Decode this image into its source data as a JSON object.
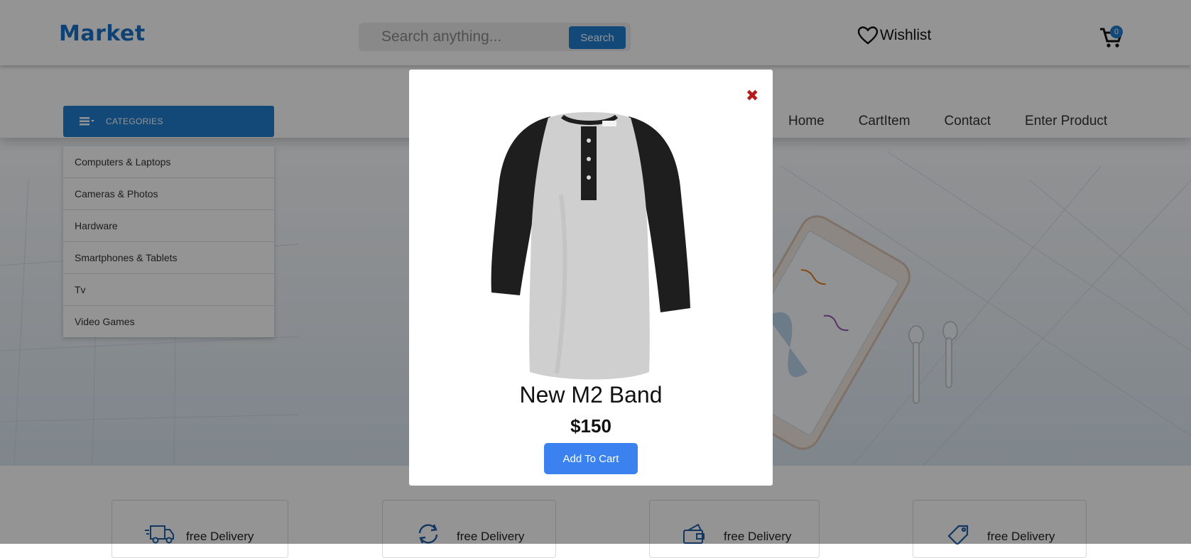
{
  "header": {
    "logo": "Market",
    "search": {
      "placeholder": "Search anything...",
      "button_label": "Search"
    },
    "wishlist_label": "Wishlist",
    "cart_count": "0"
  },
  "navbar": {
    "categories_label": "CATEGORIES",
    "links": [
      "Home",
      "CartItem",
      "Contact",
      "Enter Product"
    ]
  },
  "categories": [
    "Computers & Laptops",
    "Cameras & Photos",
    "Hardware",
    "Smartphones & Tablets",
    "Tv",
    "Video Games"
  ],
  "features": [
    {
      "label": "free Delivery",
      "icon": "truck-icon"
    },
    {
      "label": "free Delivery",
      "icon": "refresh-icon"
    },
    {
      "label": "free Delivery",
      "icon": "wallet-icon"
    },
    {
      "label": "free Delivery",
      "icon": "tag-icon"
    }
  ],
  "modal": {
    "close_icon": "✖",
    "product_name": "New M2 Band",
    "price": "$150",
    "button_label": "Add To Cart",
    "image": "raglan-henley-shirt-image"
  },
  "colors": {
    "brand": "#1a73c8",
    "button": "#1f7fd0",
    "add_to_cart": "#3b82f0",
    "close": "#b71c1c"
  }
}
